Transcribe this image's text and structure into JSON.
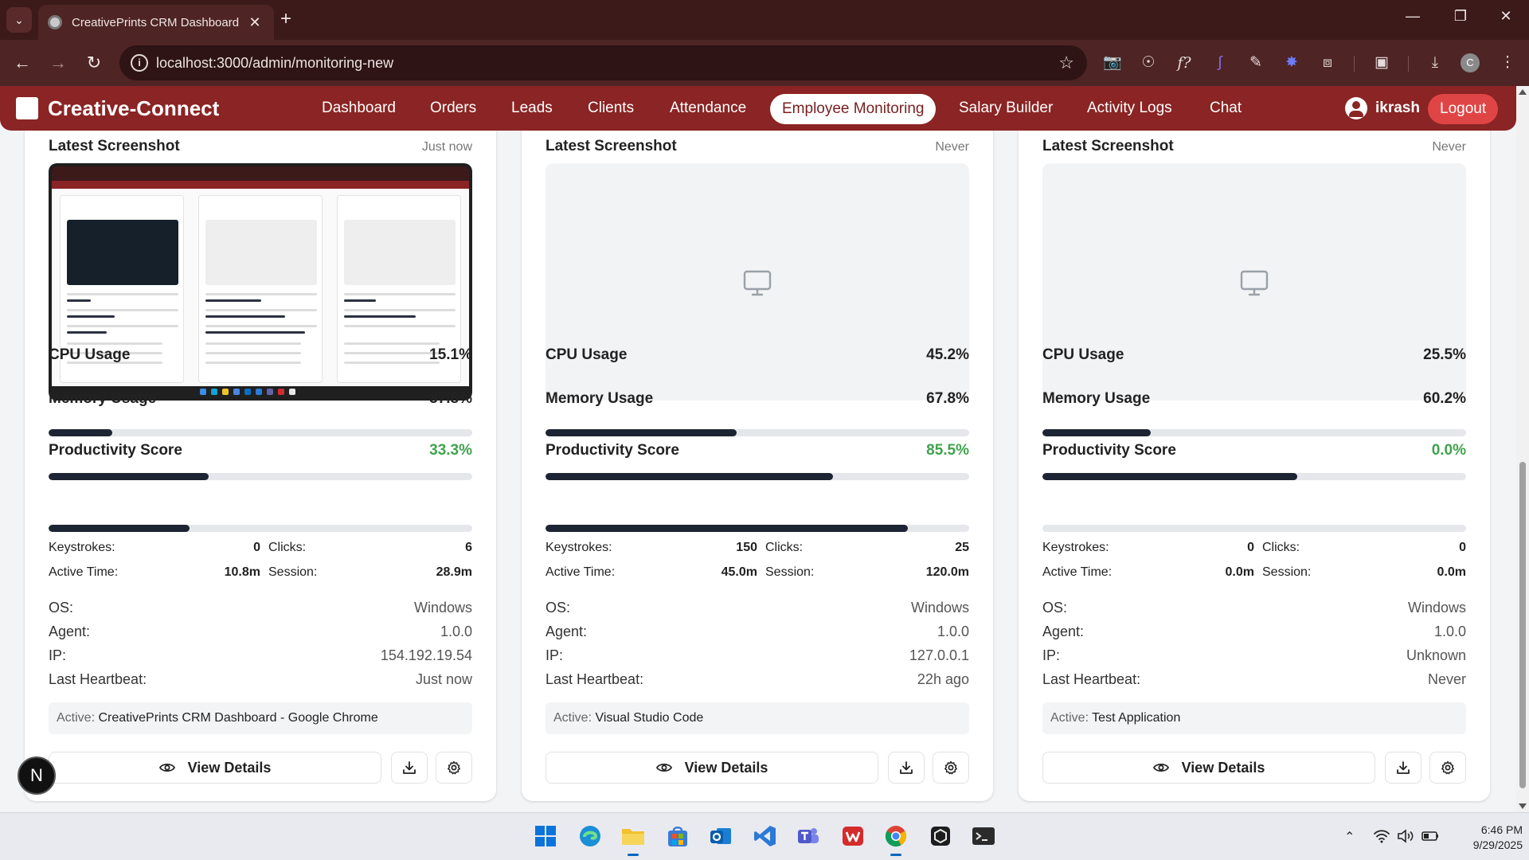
{
  "browser": {
    "tab_title": "CreativePrints CRM Dashboard",
    "url": "localhost:3000/admin/monitoring-new",
    "profile_initial": "C",
    "extensions": [
      "camera-icon",
      "compass-icon",
      "fx-icon",
      "stylus-icon",
      "eyedropper-icon",
      "settings-ext-icon",
      "puzzle-icon",
      "screenshot-icon",
      "download-icon"
    ]
  },
  "app": {
    "brand": "Creative-Connect",
    "nav": [
      "Dashboard",
      "Orders",
      "Leads",
      "Clients",
      "Attendance",
      "Employee Monitoring",
      "Salary Builder",
      "Activity Logs",
      "Chat"
    ],
    "active_nav": "Employee Monitoring",
    "user": "ikrash",
    "logout": "Logout"
  },
  "labels": {
    "latest_screenshot": "Latest Screenshot",
    "cpu": "CPU Usage",
    "memory": "Memory Usage",
    "productivity": "Productivity Score",
    "keystrokes": "Keystrokes:",
    "clicks": "Clicks:",
    "active_time": "Active Time:",
    "session": "Session:",
    "os": "OS:",
    "agent": "Agent:",
    "ip": "IP:",
    "heartbeat": "Last Heartbeat:",
    "active_prefix": "Active:",
    "view_details": "View Details"
  },
  "cards": [
    {
      "screenshot_time": "Just now",
      "has_screenshot": true,
      "cpu": "15.1%",
      "cpu_pct": 15.1,
      "memory": "37.8%",
      "memory_pct": 37.8,
      "productivity": "33.3%",
      "productivity_pct": 33.3,
      "keystrokes": "0",
      "clicks": "6",
      "active_time": "10.8m",
      "session": "28.9m",
      "os": "Windows",
      "agent": "1.0.0",
      "ip": "154.192.19.54",
      "heartbeat": "Just now",
      "active_app": "CreativePrints CRM Dashboard - Google Chrome"
    },
    {
      "screenshot_time": "Never",
      "has_screenshot": false,
      "cpu": "45.2%",
      "cpu_pct": 45.2,
      "memory": "67.8%",
      "memory_pct": 67.8,
      "productivity": "85.5%",
      "productivity_pct": 85.5,
      "keystrokes": "150",
      "clicks": "25",
      "active_time": "45.0m",
      "session": "120.0m",
      "os": "Windows",
      "agent": "1.0.0",
      "ip": "127.0.0.1",
      "heartbeat": "22h ago",
      "active_app": "Visual Studio Code"
    },
    {
      "screenshot_time": "Never",
      "has_screenshot": false,
      "cpu": "25.5%",
      "cpu_pct": 25.5,
      "memory": "60.2%",
      "memory_pct": 60.2,
      "productivity": "0.0%",
      "productivity_pct": 0,
      "keystrokes": "0",
      "clicks": "0",
      "active_time": "0.0m",
      "session": "0.0m",
      "os": "Windows",
      "agent": "1.0.0",
      "ip": "Unknown",
      "heartbeat": "Never",
      "active_app": "Test Application"
    }
  ],
  "fab": "N",
  "colors": {
    "nav_bg": "#8b2424",
    "bar_fill": "#1d2433",
    "green": "#3fa34d",
    "logout": "#e04545"
  },
  "system": {
    "time": "6:46 PM",
    "date": "9/29/2025"
  }
}
